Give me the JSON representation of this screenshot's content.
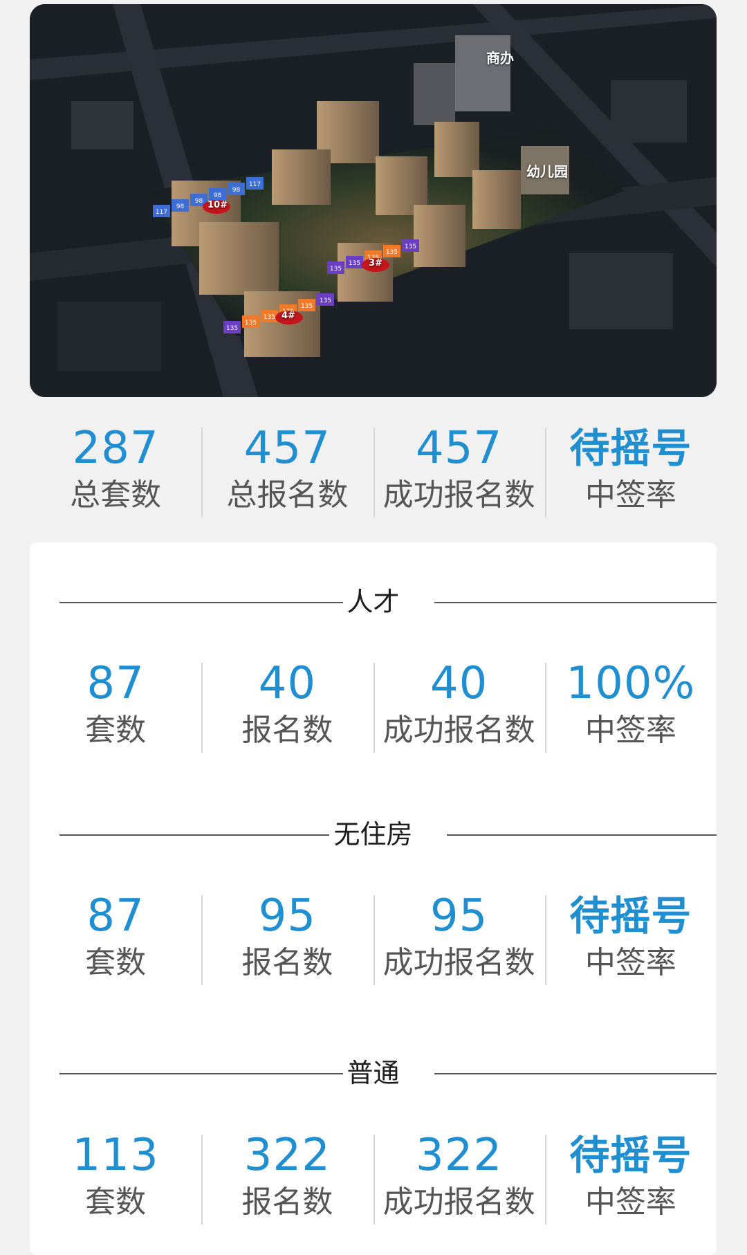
{
  "map": {
    "labels": {
      "commercial": "商办",
      "kindergarten": "幼儿园",
      "building_10": "10#",
      "building_3": "3#",
      "building_4": "4#"
    },
    "unit_tags_top": [
      "117",
      "98",
      "98",
      "98",
      "98",
      "117"
    ],
    "unit_tags_mid": [
      "135",
      "135",
      "135",
      "135",
      "135"
    ],
    "unit_tags_low": [
      "135",
      "135",
      "135",
      "135",
      "135",
      "135"
    ],
    "unit_tag_colors": {
      "blue": "#3c6ed6",
      "purple": "#6a3fc4",
      "orange": "#f07a2a"
    }
  },
  "summary": {
    "items": [
      {
        "value": "287",
        "label": "总套数"
      },
      {
        "value": "457",
        "label": "总报名数"
      },
      {
        "value": "457",
        "label": "成功报名数"
      },
      {
        "value": "待摇号",
        "label": "中签率"
      }
    ]
  },
  "sections": [
    {
      "title": "人才",
      "items": [
        {
          "value": "87",
          "label": "套数"
        },
        {
          "value": "40",
          "label": "报名数"
        },
        {
          "value": "40",
          "label": "成功报名数"
        },
        {
          "value": "100%",
          "label": "中签率"
        }
      ]
    },
    {
      "title": "无住房",
      "items": [
        {
          "value": "87",
          "label": "套数"
        },
        {
          "value": "95",
          "label": "报名数"
        },
        {
          "value": "95",
          "label": "成功报名数"
        },
        {
          "value": "待摇号",
          "label": "中签率"
        }
      ]
    },
    {
      "title": "普通",
      "items": [
        {
          "value": "113",
          "label": "套数"
        },
        {
          "value": "322",
          "label": "报名数"
        },
        {
          "value": "322",
          "label": "成功报名数"
        },
        {
          "value": "待摇号",
          "label": "中签率"
        }
      ]
    }
  ],
  "colors": {
    "accent": "#1f8fd2",
    "label": "#555555",
    "panel": "#ffffff",
    "background": "#f1f1f1"
  }
}
